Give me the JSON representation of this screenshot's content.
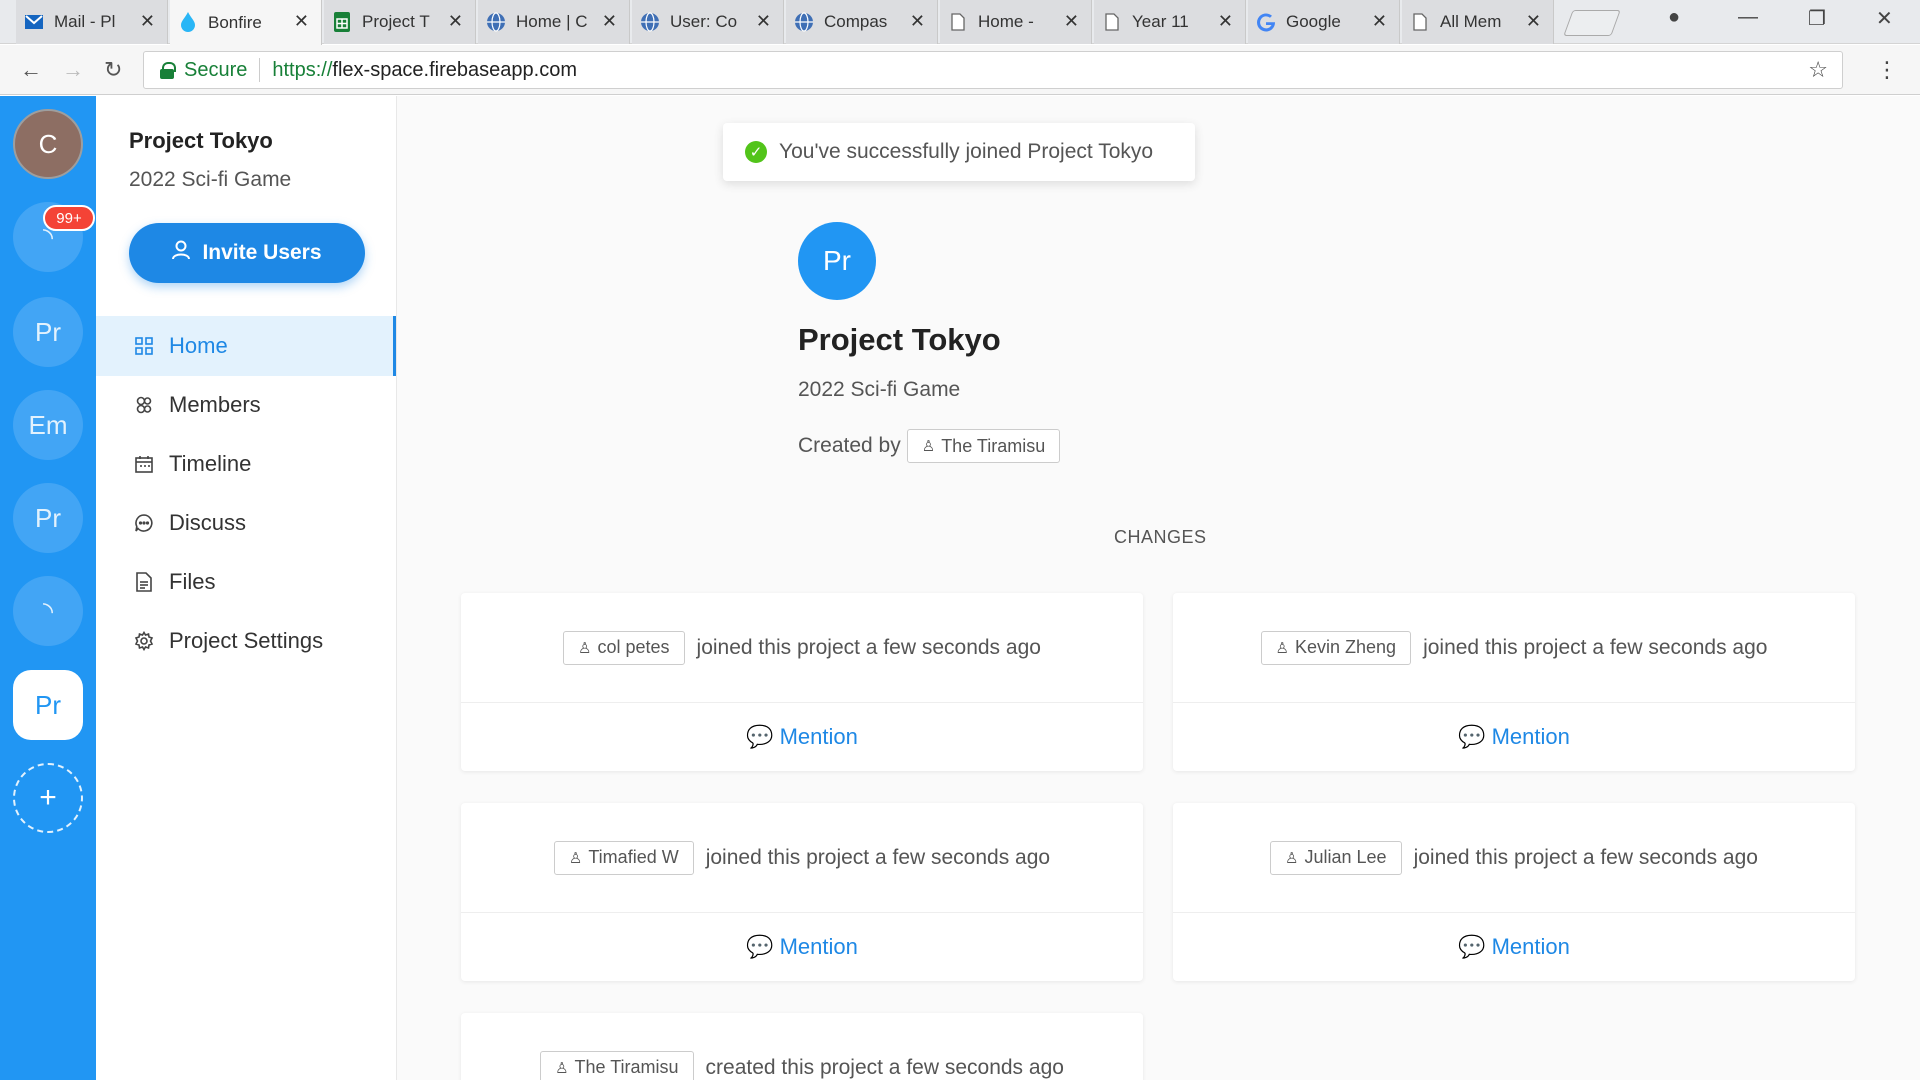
{
  "browser": {
    "tabs": [
      {
        "title": "Mail - Pl",
        "icon": "mail-icon"
      },
      {
        "title": "Bonfire",
        "icon": "flame-icon"
      },
      {
        "title": "Project T",
        "icon": "sheets-icon"
      },
      {
        "title": "Home | C",
        "icon": "globe-icon"
      },
      {
        "title": "User: Co",
        "icon": "globe-icon"
      },
      {
        "title": "Compas",
        "icon": "globe-icon"
      },
      {
        "title": "Home -",
        "icon": "page-icon"
      },
      {
        "title": "Year 11",
        "icon": "page-icon"
      },
      {
        "title": "Google",
        "icon": "google-icon"
      },
      {
        "title": "All Mem",
        "icon": "page-icon"
      }
    ],
    "address": {
      "secure_label": "Secure",
      "url_scheme": "https://",
      "url_host": "flex-space.firebaseapp.com"
    }
  },
  "rail": {
    "user_initial": "C",
    "badge": "99+",
    "loading_glyph": "◝",
    "items": [
      "Pr",
      "Em",
      "Pr"
    ],
    "active_item": "Pr",
    "add_glyph": "+"
  },
  "sidebar": {
    "project_title": "Project Tokyo",
    "project_subtitle": "2022 Sci-fi Game",
    "invite_label": "Invite Users",
    "nav": [
      {
        "label": "Home",
        "icon": "grid-icon"
      },
      {
        "label": "Members",
        "icon": "members-icon"
      },
      {
        "label": "Timeline",
        "icon": "calendar-icon"
      },
      {
        "label": "Discuss",
        "icon": "chat-icon"
      },
      {
        "label": "Files",
        "icon": "file-icon"
      },
      {
        "label": "Project Settings",
        "icon": "gear-icon"
      }
    ]
  },
  "main": {
    "toast": "You've successfully joined Project Tokyo",
    "avatar": "Pr",
    "name": "Project Tokyo",
    "description": "2022 Sci-fi Game",
    "created_by_label": "Created by",
    "creator": "The Tiramisu",
    "changes_label": "CHANGES",
    "mention_label": "Mention",
    "changes": [
      {
        "user": "col petes",
        "text": "joined this project a few seconds ago"
      },
      {
        "user": "Kevin Zheng",
        "text": "joined this project a few seconds ago"
      },
      {
        "user": "Timafied W",
        "text": "joined this project a few seconds ago"
      },
      {
        "user": "Julian Lee",
        "text": "joined this project a few seconds ago"
      },
      {
        "user": "The Tiramisu",
        "text": "created this project a few seconds ago"
      }
    ]
  },
  "colors": {
    "primary": "#2196f3",
    "accent": "#1e88e5",
    "success": "#52c41a",
    "badge": "#f44336"
  }
}
